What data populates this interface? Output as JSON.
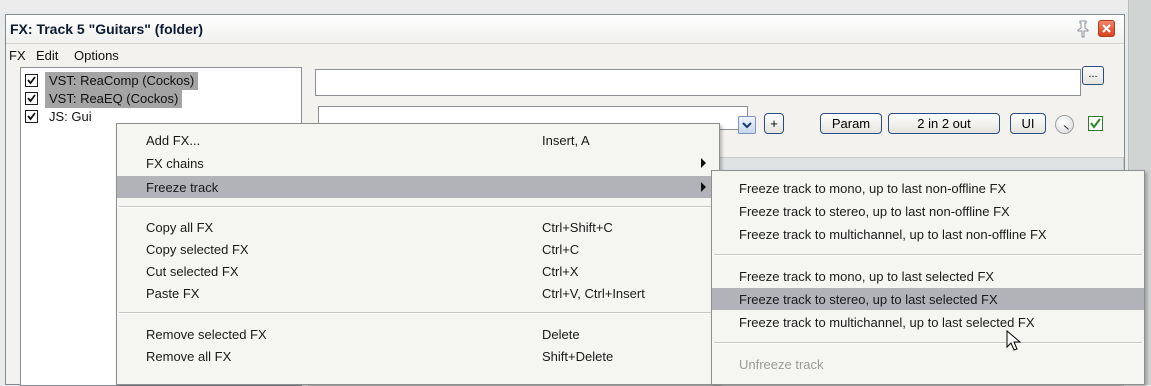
{
  "window": {
    "title": "FX: Track 5 \"Guitars\" (folder)",
    "pin_icon": "pin-icon",
    "close_icon": "close-icon",
    "accent_close": "#d8431f"
  },
  "menubar": [
    "FX",
    "Edit",
    "Options"
  ],
  "fx_list": [
    {
      "label": "VST: ReaComp (Cockos)",
      "checked": true,
      "selected": true
    },
    {
      "label": "VST: ReaEQ (Cockos)",
      "checked": true,
      "selected": true
    },
    {
      "label": "JS: Gui",
      "checked": true,
      "selected": false
    }
  ],
  "toolbar": {
    "dots_label": "...",
    "plus_label": "+",
    "param_label": "Param",
    "io_label": "2 in 2 out",
    "ui_label": "UI"
  },
  "context_menu": {
    "items": [
      {
        "label": "Add FX...",
        "shortcut": "Insert, A"
      },
      {
        "label": "FX chains",
        "shortcut": "",
        "submenu": true
      },
      {
        "label": "Freeze track",
        "shortcut": "",
        "submenu": true,
        "highlighted": true
      },
      {
        "label": "Copy all FX",
        "shortcut": "Ctrl+Shift+C"
      },
      {
        "label": "Copy selected FX",
        "shortcut": "Ctrl+C"
      },
      {
        "label": "Cut selected FX",
        "shortcut": "Ctrl+X"
      },
      {
        "label": "Paste FX",
        "shortcut": "Ctrl+V, Ctrl+Insert"
      },
      {
        "label": "Remove selected FX",
        "shortcut": "Delete"
      },
      {
        "label": "Remove all FX",
        "shortcut": "Shift+Delete"
      }
    ]
  },
  "freeze_submenu": {
    "items": [
      {
        "label": "Freeze track to mono, up to last non-offline FX"
      },
      {
        "label": "Freeze track to stereo, up to last non-offline FX"
      },
      {
        "label": "Freeze track to multichannel, up to last non-offline FX"
      },
      {
        "label": "Freeze track to mono, up to last selected FX"
      },
      {
        "label": "Freeze track to stereo, up to last selected FX",
        "highlighted": true
      },
      {
        "label": "Freeze track to multichannel, up to last selected FX"
      },
      {
        "label": "Unfreeze track",
        "disabled": true
      }
    ]
  }
}
